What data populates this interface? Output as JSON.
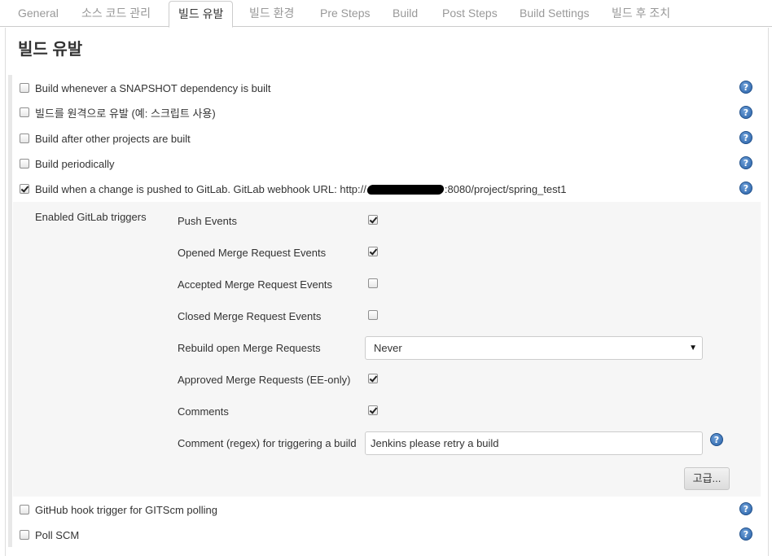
{
  "tabs": [
    {
      "label": "General"
    },
    {
      "label": "소스 코드 관리"
    },
    {
      "label": "빌드 유발",
      "active": true
    },
    {
      "label": "빌드 환경"
    },
    {
      "label": "Pre Steps"
    },
    {
      "label": "Build"
    },
    {
      "label": "Post Steps"
    },
    {
      "label": "Build Settings"
    },
    {
      "label": "빌드 후 조치"
    }
  ],
  "section": {
    "title": "빌드 유발"
  },
  "triggers": [
    {
      "label": "Build whenever a SNAPSHOT dependency is built",
      "checked": false
    },
    {
      "label": "빌드를 원격으로 유발 (예: 스크립트 사용)",
      "checked": false
    },
    {
      "label": "Build after other projects are built",
      "checked": false
    },
    {
      "label": "Build periodically",
      "checked": false
    },
    {
      "label_prefix": "Build when a change is pushed to GitLab. GitLab webhook URL: http://",
      "label_suffix": ":8080/project/spring_test1",
      "checked": true
    },
    {
      "label": "GitHub hook trigger for GITScm polling",
      "checked": false
    },
    {
      "label": "Poll SCM",
      "checked": false
    }
  ],
  "gitlab": {
    "header": "Enabled GitLab triggers",
    "options": [
      {
        "label": "Push Events",
        "checked": true
      },
      {
        "label": "Opened Merge Request Events",
        "checked": true
      },
      {
        "label": "Accepted Merge Request Events",
        "checked": false
      },
      {
        "label": "Closed Merge Request Events",
        "checked": false
      },
      {
        "label": "Rebuild open Merge Requests",
        "value": "Never"
      },
      {
        "label": "Approved Merge Requests (EE-only)",
        "checked": true
      },
      {
        "label": "Comments",
        "checked": true
      },
      {
        "label": "Comment (regex) for triggering a build",
        "value": "Jenkins please retry a build"
      }
    ],
    "advanced_button": "고급..."
  },
  "help_icon": "question-circle-icon",
  "colors": {
    "help": "#2962a8",
    "panel_bg": "#f6f6f6",
    "border": "#cccccc"
  }
}
